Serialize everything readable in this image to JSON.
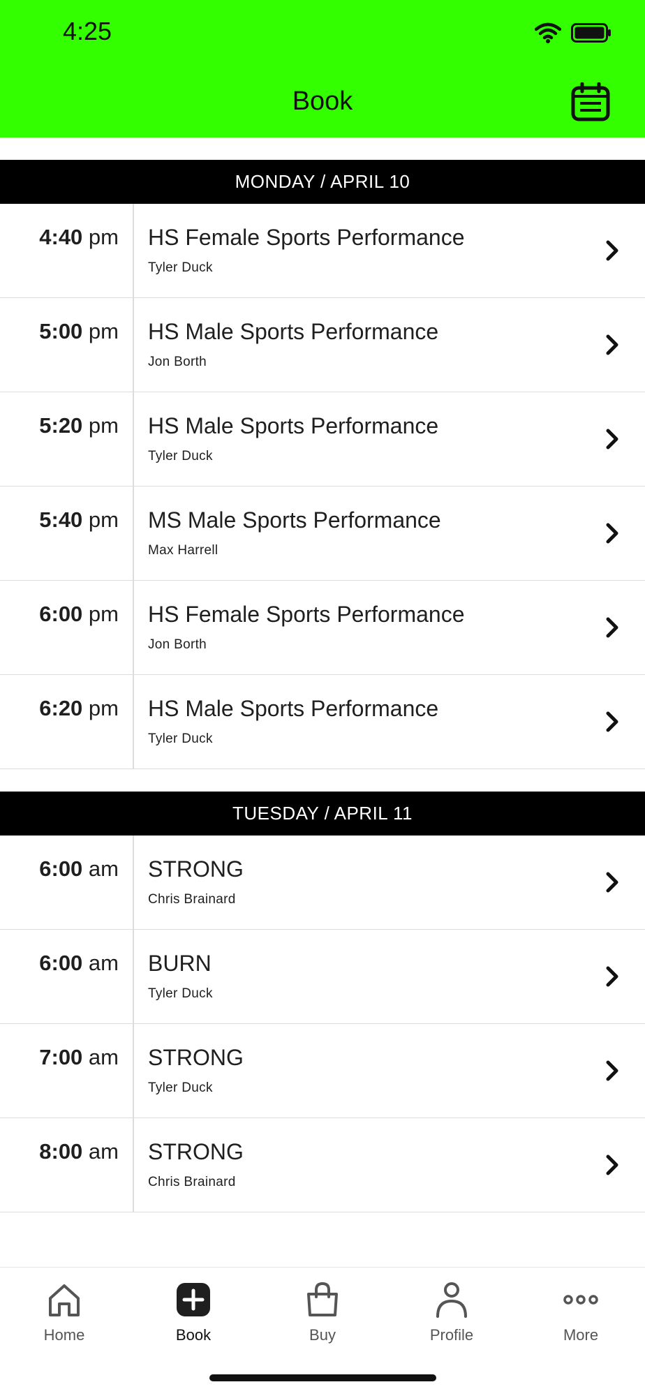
{
  "status_bar": {
    "time": "4:25"
  },
  "header": {
    "title": "Book",
    "bg_color": "#33ff00"
  },
  "days": [
    {
      "label": "MONDAY / APRIL 10",
      "classes": [
        {
          "time": "4:40",
          "ampm": "pm",
          "name": "HS Female Sports Performance",
          "instructor": "Tyler Duck"
        },
        {
          "time": "5:00",
          "ampm": "pm",
          "name": "HS Male Sports Performance",
          "instructor": "Jon Borth"
        },
        {
          "time": "5:20",
          "ampm": "pm",
          "name": "HS Male Sports Performance",
          "instructor": "Tyler Duck"
        },
        {
          "time": "5:40",
          "ampm": "pm",
          "name": "MS Male Sports Performance",
          "instructor": "Max Harrell"
        },
        {
          "time": "6:00",
          "ampm": "pm",
          "name": "HS Female Sports Performance",
          "instructor": "Jon Borth"
        },
        {
          "time": "6:20",
          "ampm": "pm",
          "name": "HS Male Sports Performance",
          "instructor": "Tyler Duck"
        }
      ]
    },
    {
      "label": "TUESDAY / APRIL 11",
      "classes": [
        {
          "time": "6:00",
          "ampm": "am",
          "name": "STRONG",
          "instructor": "Chris Brainard"
        },
        {
          "time": "6:00",
          "ampm": "am",
          "name": "BURN",
          "instructor": "Tyler Duck"
        },
        {
          "time": "7:00",
          "ampm": "am",
          "name": "STRONG",
          "instructor": "Tyler Duck"
        },
        {
          "time": "8:00",
          "ampm": "am",
          "name": "STRONG",
          "instructor": "Chris Brainard"
        }
      ]
    }
  ],
  "tabs": [
    {
      "label": "Home",
      "icon": "home-icon"
    },
    {
      "label": "Book",
      "icon": "plus-square-icon",
      "active": true
    },
    {
      "label": "Buy",
      "icon": "shopping-bag-icon"
    },
    {
      "label": "Profile",
      "icon": "person-icon"
    },
    {
      "label": "More",
      "icon": "more-dots-icon"
    }
  ]
}
